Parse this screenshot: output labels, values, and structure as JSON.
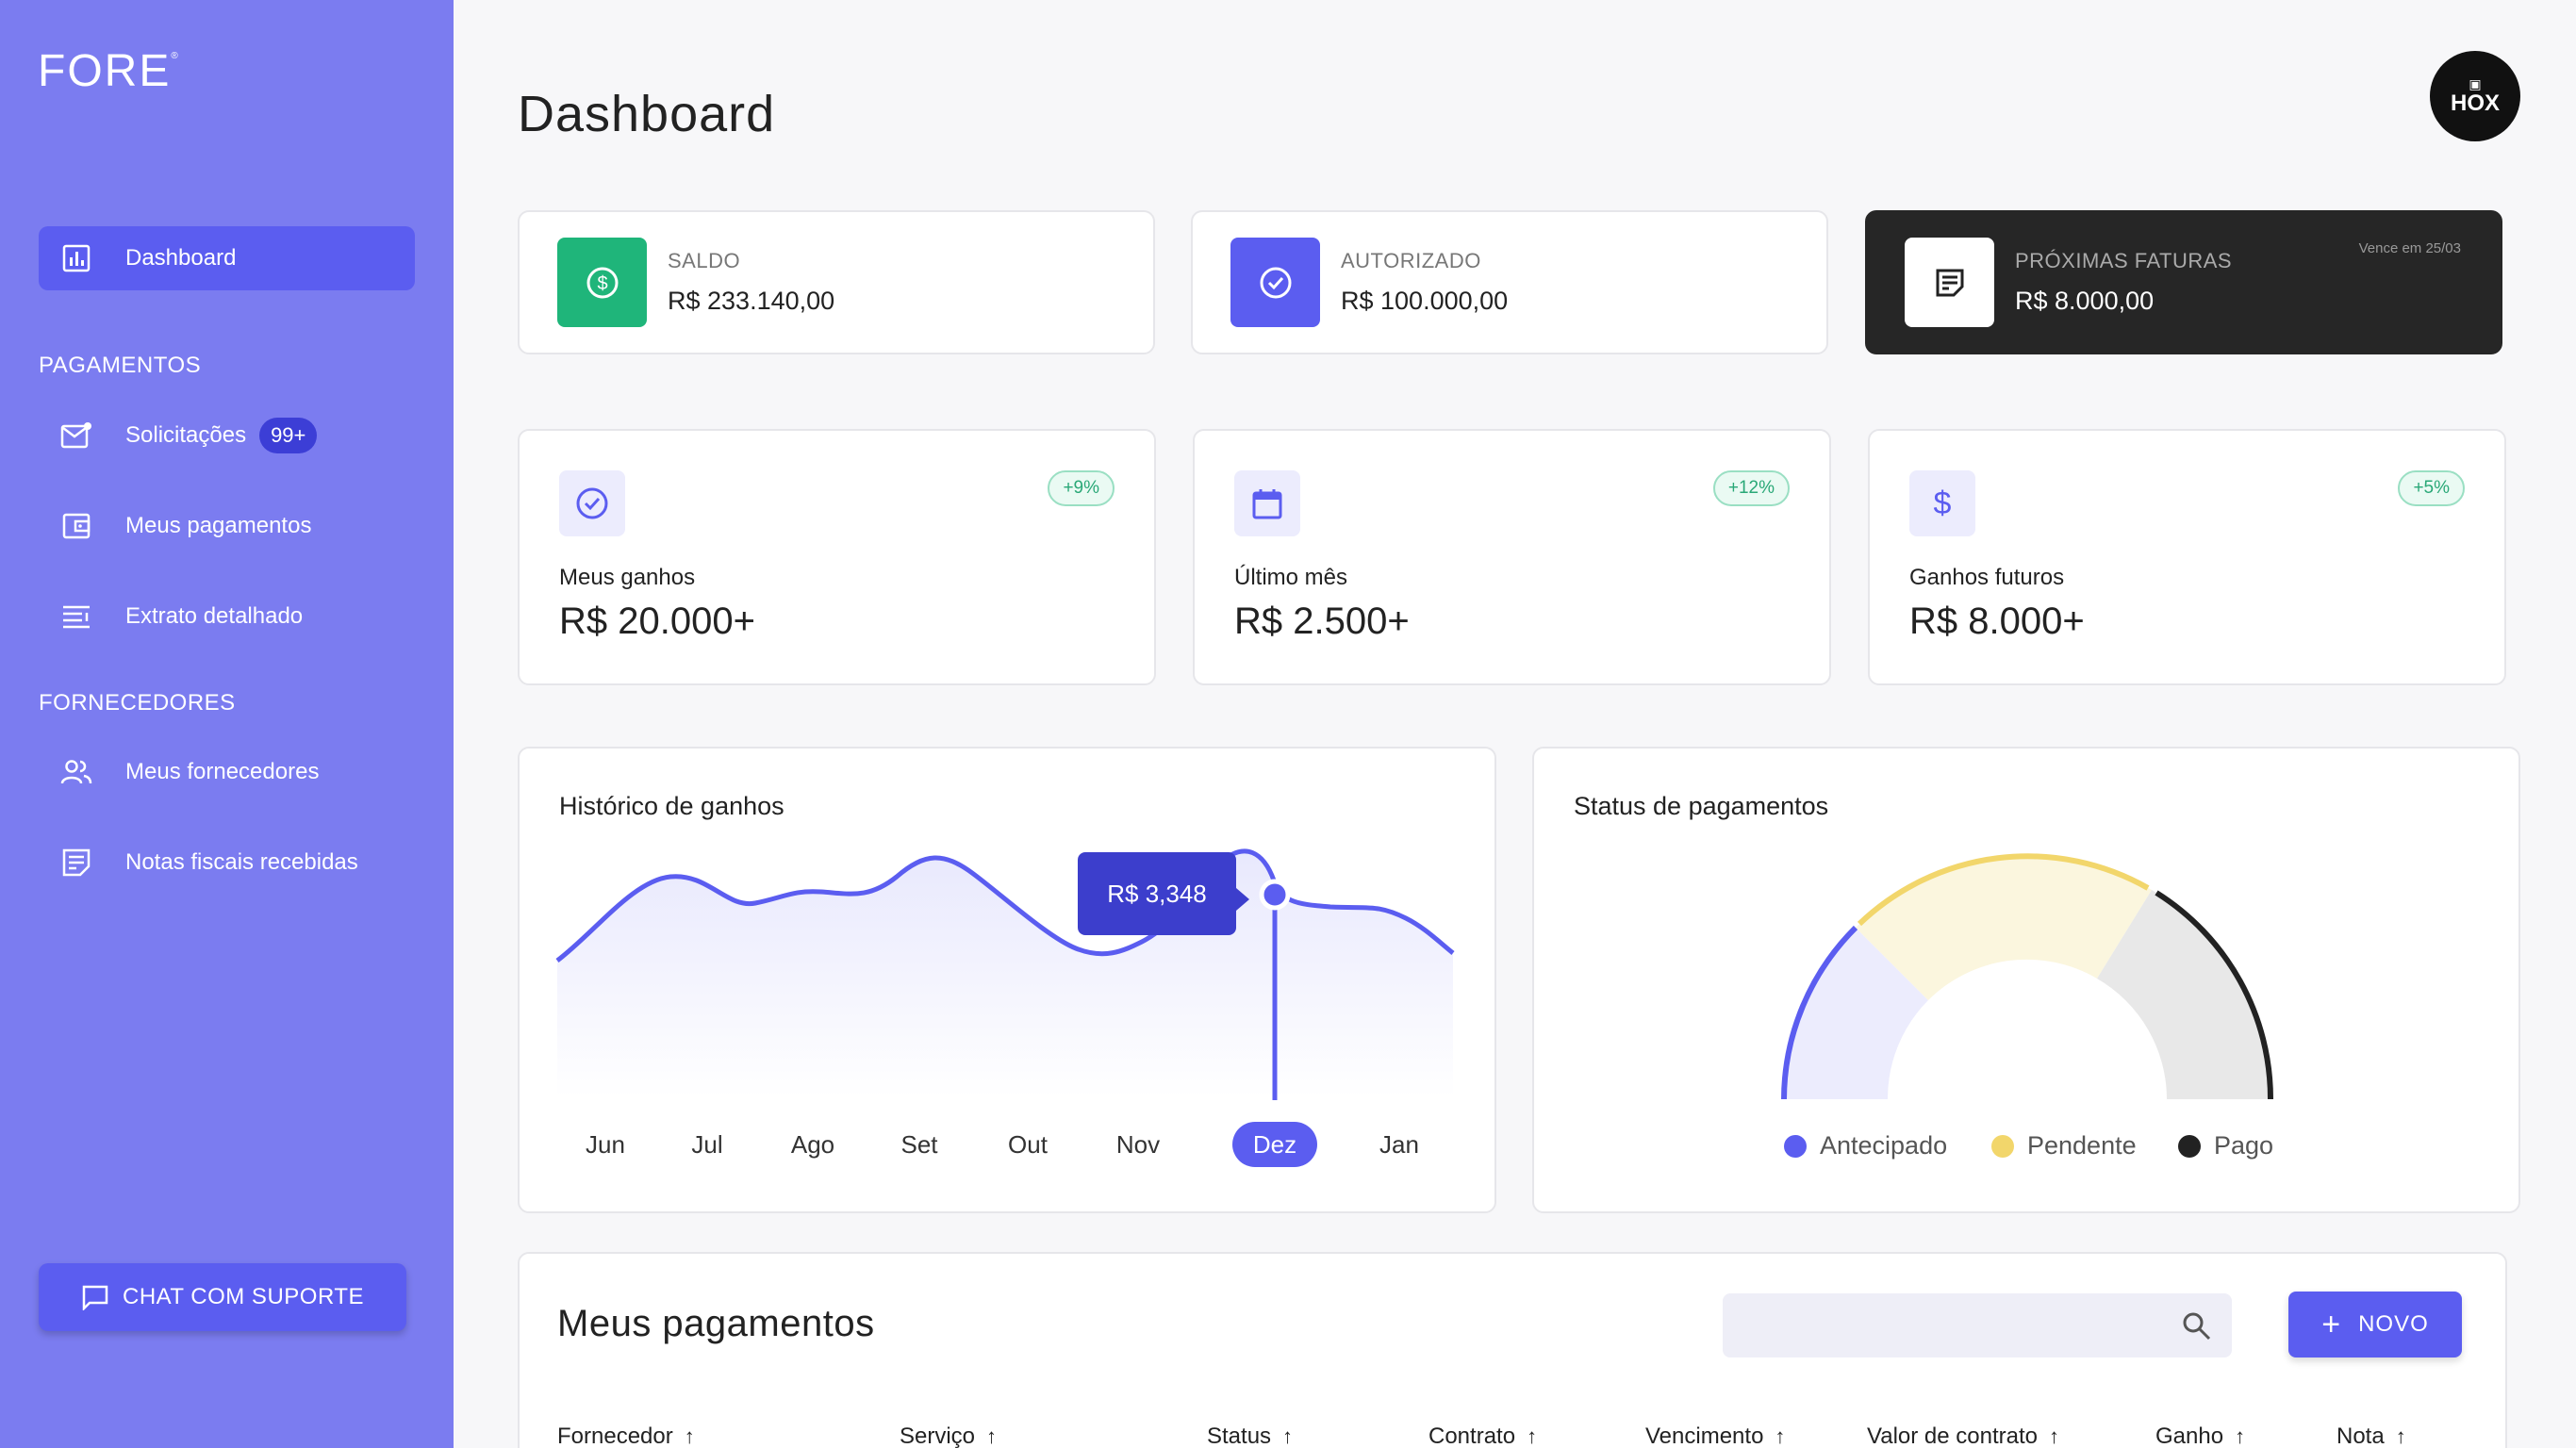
{
  "brand": {
    "logo": "FORE",
    "logo_mark": "®"
  },
  "sidebar": {
    "active_item": "Dashboard",
    "section_payments": "PAGAMENTOS",
    "payments_items": [
      {
        "label": "Solicitações",
        "badge": "99+",
        "icon": "mail-icon"
      },
      {
        "label": "Meus pagamentos",
        "icon": "wallet-icon"
      },
      {
        "label": "Extrato detalhado",
        "icon": "list-icon"
      }
    ],
    "section_suppliers": "FORNECEDORES",
    "supplier_items": [
      {
        "label": "Meus fornecedores",
        "icon": "people-icon"
      },
      {
        "label": "Notas fiscais recebidas",
        "icon": "document-icon"
      }
    ],
    "chat_button": "CHAT COM SUPORTE"
  },
  "header": {
    "title": "Dashboard",
    "avatar_text": "HOX"
  },
  "summary_cards": [
    {
      "label": "SALDO",
      "value": "R$ 233.140,00",
      "icon": "dollar-icon",
      "color": "#1fb57a"
    },
    {
      "label": "AUTORIZADO",
      "value": "R$ 100.000,00",
      "icon": "check-icon",
      "color": "#5b5df0"
    },
    {
      "label": "PRÓXIMAS FATURAS",
      "value": "R$ 8.000,00",
      "icon": "invoice-icon",
      "due": "Vence em 25/03"
    }
  ],
  "stat_cards": [
    {
      "label": "Meus ganhos",
      "value": "R$ 20.000+",
      "change": "+9%",
      "icon": "check-icon"
    },
    {
      "label": "Último mês",
      "value": "R$ 2.500+",
      "change": "+12%",
      "icon": "calendar-icon"
    },
    {
      "label": "Ganhos futuros",
      "value": "R$ 8.000+",
      "change": "+5%",
      "icon": "dollar-icon"
    }
  ],
  "history_chart": {
    "title": "Histórico de ganhos",
    "months": [
      "Jun",
      "Jul",
      "Ago",
      "Set",
      "Out",
      "Nov",
      "Dez",
      "Jan"
    ],
    "active_month": "Dez",
    "tooltip": "R$ 3,348"
  },
  "status_chart": {
    "title": "Status de pagamentos",
    "legend": [
      {
        "label": "Antecipado",
        "color": "#5b5df0"
      },
      {
        "label": "Pendente",
        "color": "#f2d66b"
      },
      {
        "label": "Pago",
        "color": "#222222"
      }
    ]
  },
  "payments_table": {
    "title": "Meus pagamentos",
    "search_placeholder": "",
    "new_button": "NOVO",
    "columns": [
      "Fornecedor",
      "Serviço",
      "Status",
      "Contrato",
      "Vencimento",
      "Valor de contrato",
      "Ganho",
      "Nota"
    ]
  },
  "colors": {
    "sidebar": "#7b7cf0",
    "accent": "#5b5df0",
    "success": "#1fb57a",
    "dark_card": "#262626"
  },
  "chart_data": {
    "type": "area",
    "title": "Histórico de ganhos",
    "categories": [
      "Jun",
      "Jul",
      "Ago",
      "Set",
      "Out",
      "Nov",
      "Dez",
      "Jan"
    ],
    "highlight": {
      "category": "Dez",
      "label": "R$ 3,348"
    }
  }
}
